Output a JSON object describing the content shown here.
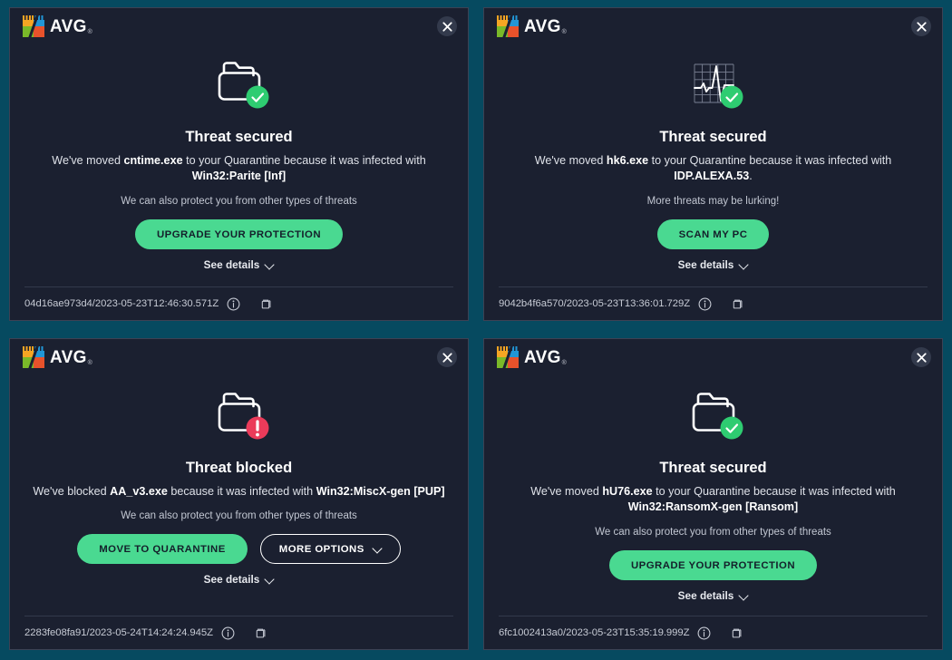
{
  "brand": {
    "name": "AVG",
    "trademark": "®",
    "logo_icon": "avg-shield-icon"
  },
  "common": {
    "close_label": "×",
    "see_details_label": "See details",
    "info_icon": "info-icon",
    "copy_icon": "copy-icon",
    "chevron_down_icon": "chevron-down-icon",
    "accent_green": "#4ad991",
    "alert_red": "#eb3b5a",
    "panel_bg": "#1b2030",
    "panel_border": "#3c4254",
    "page_bg": "#064a60"
  },
  "panels": [
    {
      "icon": "folder-check-icon",
      "status_color": "#2ecc71",
      "headline": "Threat secured",
      "message_prefix": "We've moved ",
      "file_name": "cntime.exe",
      "message_middle": " to your Quarantine because it was infected with ",
      "threat_name": "Win32:Parite [Inf]",
      "message_suffix": "",
      "subtext": "We can also protect you from other types of threats",
      "primary_button": "UPGRADE YOUR PROTECTION",
      "secondary_button": null,
      "see_details": "See details",
      "trace_id": "04d16ae973d4/2023-05-23T12:46:30.571Z"
    },
    {
      "icon": "chart-check-icon",
      "status_color": "#2ecc71",
      "headline": "Threat secured",
      "message_prefix": "We've moved ",
      "file_name": "hk6.exe",
      "message_middle": " to your Quarantine because it was infected with ",
      "threat_name": "IDP.ALEXA.53",
      "message_suffix": ".",
      "subtext": "More threats may be lurking!",
      "primary_button": "SCAN MY PC",
      "secondary_button": null,
      "see_details": "See details",
      "trace_id": "9042b4f6a570/2023-05-23T13:36:01.729Z"
    },
    {
      "icon": "folder-alert-icon",
      "status_color": "#eb3b5a",
      "headline": "Threat blocked",
      "message_prefix": "We've blocked ",
      "file_name": "AA_v3.exe",
      "message_middle": " because it was infected with ",
      "threat_name": "Win32:MiscX-gen [PUP]",
      "message_suffix": "",
      "subtext": "We can also protect you from other types of threats",
      "primary_button": "MOVE TO QUARANTINE",
      "secondary_button": "MORE OPTIONS",
      "see_details": "See details",
      "trace_id": "2283fe08fa91/2023-05-24T14:24:24.945Z"
    },
    {
      "icon": "folder-check-icon",
      "status_color": "#2ecc71",
      "headline": "Threat secured",
      "message_prefix": "We've moved ",
      "file_name": "hU76.exe",
      "message_middle": " to your Quarantine because it was infected with ",
      "threat_name": "Win32:RansomX-gen [Ransom]",
      "message_suffix": "",
      "subtext": "We can also protect you from other types of threats",
      "primary_button": "UPGRADE YOUR PROTECTION",
      "secondary_button": null,
      "see_details": "See details",
      "trace_id": "6fc1002413a0/2023-05-23T15:35:19.999Z"
    }
  ]
}
